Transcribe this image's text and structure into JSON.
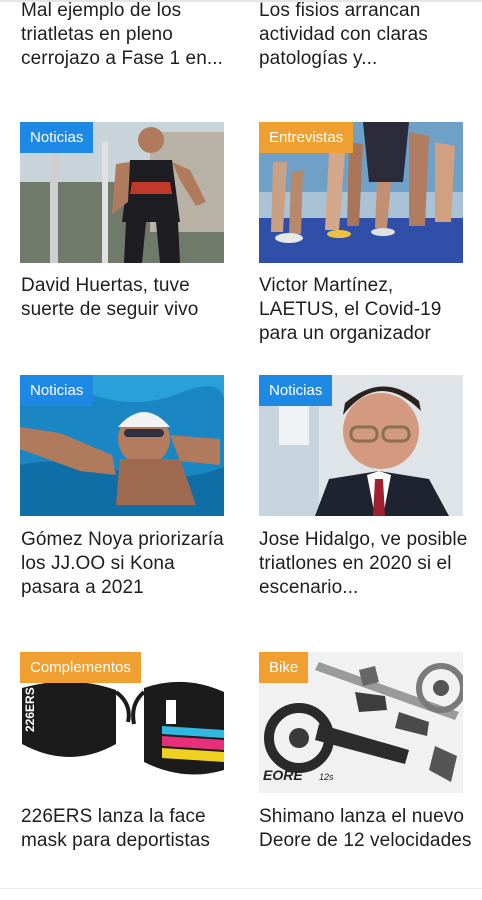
{
  "articles": [
    {
      "title": "Mal ejemplo de los triatletas en pleno cerrojazo a Fase 1 en..."
    },
    {
      "title": "Los fisios arrancan actividad con claras patologías y..."
    },
    {
      "category": "Noticias",
      "category_color": "#1e88e5",
      "image": "triathlete-running-photo",
      "title": "David Huertas, tuve suerte de seguir vivo"
    },
    {
      "category": "Entrevistas",
      "category_color": "#f0a030",
      "image": "runners-legs-photo",
      "title": "Victor Martínez, LAETUS, el Covid-19 para un organizador"
    },
    {
      "category": "Noticias",
      "category_color": "#1e88e5",
      "image": "swimmer-photo",
      "title": "Gómez Noya priorizaría los JJ.OO si Kona pasara a 2021"
    },
    {
      "category": "Noticias",
      "category_color": "#1e88e5",
      "image": "man-portrait-photo",
      "title": "Jose Hidalgo, ve posible triatlones en 2020 si el escenario..."
    },
    {
      "category": "Complementos",
      "category_color": "#f0a030",
      "image": "face-masks-photo",
      "mask_brand": "226ERS",
      "title": "226ERS lanza la face mask para deportistas"
    },
    {
      "category": "Bike",
      "category_color": "#f0a030",
      "image": "bike-components-photo",
      "product_logo": "EORE",
      "product_speed": "12s",
      "title": "Shimano lanza el nuevo Deore de 12 velocidades"
    }
  ]
}
